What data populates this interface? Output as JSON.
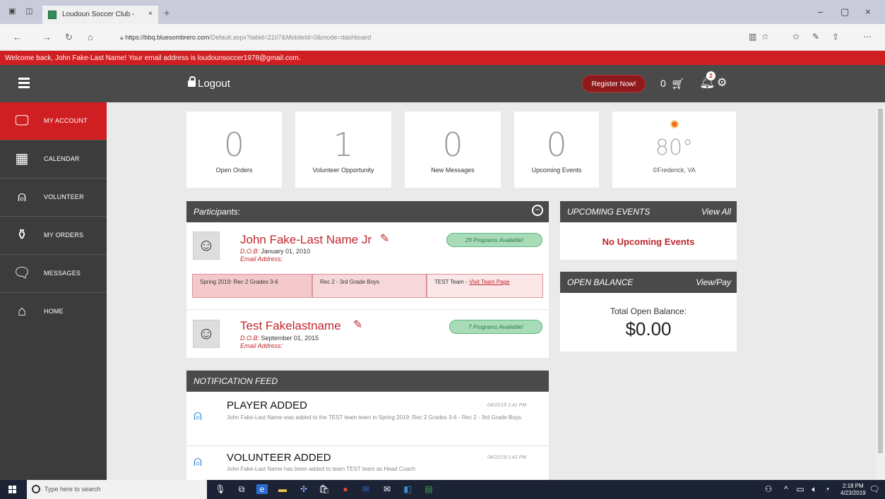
{
  "browser": {
    "tab_title": "Loudoun Soccer Club -",
    "tab_close": "×",
    "new_tab": "+",
    "url_domain": "https://bbq.bluesombrero.com",
    "url_rest": "/Default.aspx?tabid=2107&MobileId=0&mode=dashboard",
    "minimize": "–",
    "maximize": "▢",
    "close": "×"
  },
  "welcome_message": "Welcome back, John Fake-Last Name! Your email address is loudounsoccer1978@gmail.com.",
  "header": {
    "logout_label": "Logout",
    "register_label": "Register Now!",
    "cart_count": "0",
    "notification_count": "2"
  },
  "sidebar": {
    "items": [
      {
        "label": "MY ACCOUNT",
        "icon": "monitor-icon"
      },
      {
        "label": "CALENDAR",
        "icon": "calendar-icon"
      },
      {
        "label": "VOLUNTEER",
        "icon": "person-icon"
      },
      {
        "label": "MY ORDERS",
        "icon": "bottle-icon"
      },
      {
        "label": "MESSAGES",
        "icon": "chat-icon"
      },
      {
        "label": "HOME",
        "icon": "home-icon"
      }
    ]
  },
  "cards": [
    {
      "value": "0",
      "label": "Open Orders"
    },
    {
      "value": "1",
      "label": "Volunteer Opportunity"
    },
    {
      "value": "0",
      "label": "New Messages"
    },
    {
      "value": "0",
      "label": "Upcoming Events"
    }
  ],
  "weather": {
    "temp": "80°",
    "location": "Frederick, VA"
  },
  "participants": {
    "title": "Participants:",
    "people": [
      {
        "name": "John Fake-Last Name Jr",
        "dob_label": "D.O.B:",
        "dob": "January 01, 2010",
        "email_label": "Email Address:",
        "programs": "29 Programs Available!",
        "crumbs": {
          "season": "Spring 2019: Rec 2 Grades 3-6",
          "division": "Rec 2 - 3rd Grade Boys",
          "team": "TEST Team - ",
          "team_link": "Visit Team Page"
        }
      },
      {
        "name": "Test Fakelastname",
        "dob_label": "D.O.B:",
        "dob": "September 01, 2015",
        "email_label": "Email Address:",
        "programs": "7 Programs Available!"
      }
    ]
  },
  "notification_feed": {
    "title": "NOTIFICATION FEED",
    "items": [
      {
        "title": "PLAYER ADDED",
        "date": "04/22/19 1:41 PM",
        "text": "John Fake-Last Name was added to the TEST team team in Spring 2019: Rec 2 Grades 3-6 - Rec 2 - 3rd Grade Boys."
      },
      {
        "title": "VOLUNTEER ADDED",
        "date": "04/22/19 1:41 PM",
        "text": "John Fake-Last Name has been added to team TEST team as Head Coach"
      }
    ]
  },
  "upcoming_events": {
    "title": "UPCOMING EVENTS",
    "link": "View All",
    "empty": "No Upcoming Events"
  },
  "open_balance": {
    "title": "OPEN BALANCE",
    "link": "View/Pay",
    "label": "Total Open Balance:",
    "amount": "$0.00"
  },
  "taskbar": {
    "search_placeholder": "Type here to search",
    "time": "2:18 PM",
    "date": "4/23/2019"
  }
}
